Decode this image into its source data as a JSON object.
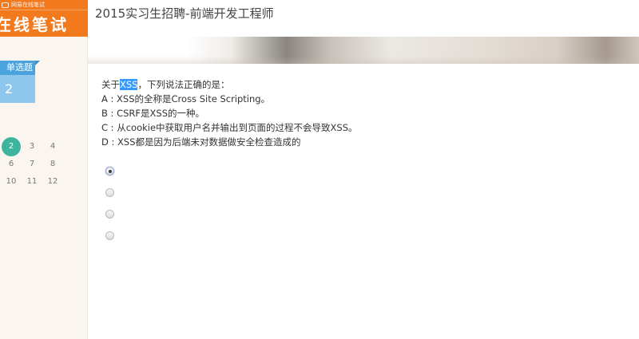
{
  "header": {
    "logo_small_text": "网易在线笔试",
    "logo_text": "在线笔试",
    "title": "2015实习生招聘-前端开发工程师"
  },
  "sidebar": {
    "question_type": "单选题",
    "count": "2",
    "question_numbers": [
      "2",
      "3",
      "4",
      "6",
      "7",
      "8",
      "10",
      "11",
      "12"
    ],
    "active_question": "2"
  },
  "question": {
    "prefix": "关于",
    "highlight": "XSS",
    "suffix": "，下列说法正确的是：",
    "options": [
      "A : XSS的全称是Cross Site Scripting。",
      "B : CSRF是XSS的一种。",
      "C : 从cookie中获取用户名并输出到页面的过程不会导致XSS。",
      "D : XSS都是因为后端未对数据做安全检查造成的"
    ],
    "selected_index": 0
  },
  "colors": {
    "brand_orange": "#f27a1d",
    "tab_blue": "#4aa3dc",
    "active_green": "#3cb59c",
    "highlight_blue": "#3399ff"
  }
}
